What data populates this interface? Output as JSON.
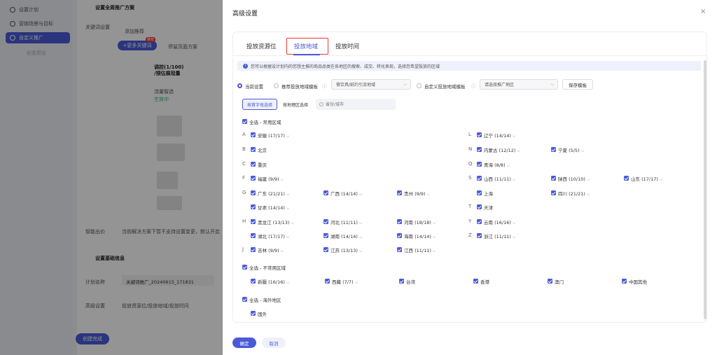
{
  "background": {
    "sidebar": [
      "设置计划",
      "营销场景与目标",
      "自定义推广",
      "创意预览"
    ],
    "section_title_1": "设置全周推广方案",
    "keyword_label": "关键词设置",
    "keyword_tip": "添加推荐",
    "more_btn": "+更多关键词",
    "badge": "推荐",
    "bid_label": "停留页面方案",
    "col_header": "调控(1/100)\n/预估展现量",
    "row1": "流量智选",
    "row1_status": "生效中",
    "smart_label": "智能出价",
    "smart_tip": "当前解决方案下暂不支持设置变更，默认开启",
    "section_title_2": "设置基础信息",
    "plan_name_label": "计划名称",
    "plan_name_value": "关键词推广_20240615_171831",
    "advanced_label": "高级设置",
    "advanced_value": "投放资源位/投放地域/投放时间",
    "create_btn": "创建完成"
  },
  "modal": {
    "title": "高级设置",
    "tabs": [
      "投放资源位",
      "投放地域",
      "投放时间"
    ],
    "notice": "您可以根据设计划内的您想主推的商品品类在各地区的搜索、成交、转化表现，选择您希望投放的区域",
    "options": {
      "current": "当前设置",
      "recommend": "推荐投放地域模板",
      "recommend_select": "餐饮具/纸约引流地域",
      "custom": "自定义投放地域模板",
      "custom_select": "请选择推广地区",
      "save": "保存模板"
    },
    "seg": [
      "按首字母选择",
      "按地理区选择"
    ],
    "search_placeholder": "省份/城市",
    "groups": {
      "common": "全选 - 常用区域",
      "uncommon": "全选 - 不常用区域",
      "overseas": "全选 - 海外地区"
    },
    "provinces": {
      "A1": "安徽 (17/17)",
      "B1": "北京",
      "C1": "重庆",
      "F1": "福建 (9/9)",
      "G1": "广东 (21/21)",
      "G2": "广西 (14/14)",
      "G3": "贵州 (9/9)",
      "G4": "甘肃 (14/14)",
      "H1": "黑龙江 (13/13)",
      "H2": "河北 (11/11)",
      "H3": "河南 (18/18)",
      "H4": "湖北 (17/17)",
      "H5": "湖南 (14/14)",
      "H6": "海南 (14/14)",
      "J1": "吉林 (9/9)",
      "J2": "江苏 (13/13)",
      "J3": "江西 (11/11)",
      "L1": "辽宁 (14/14)",
      "N1": "内蒙古 (12/12)",
      "N2": "宁夏 (5/5)",
      "Q1": "青海 (8/8)",
      "S1": "山西 (11/11)",
      "S2": "陕西 (10/10)",
      "S3": "山东 (17/17)",
      "S4": "上海",
      "S5": "四川 (21/21)",
      "T1": "天津",
      "Y1": "云南 (16/16)",
      "Z1": "浙江 (11/11)"
    },
    "uncommon": [
      "新疆 (16/16)",
      "西藏 (7/7)",
      "台湾",
      "香港",
      "澳门",
      "中国其他"
    ],
    "overseas": [
      "国外"
    ],
    "letters_left": [
      "A",
      "B",
      "C",
      "F",
      "G",
      "H",
      "J"
    ],
    "letters_right": [
      "L",
      "N",
      "Q",
      "S",
      "T",
      "Y",
      "Z"
    ],
    "confirm": "确定",
    "cancel": "取消",
    "close_icon": "×"
  }
}
